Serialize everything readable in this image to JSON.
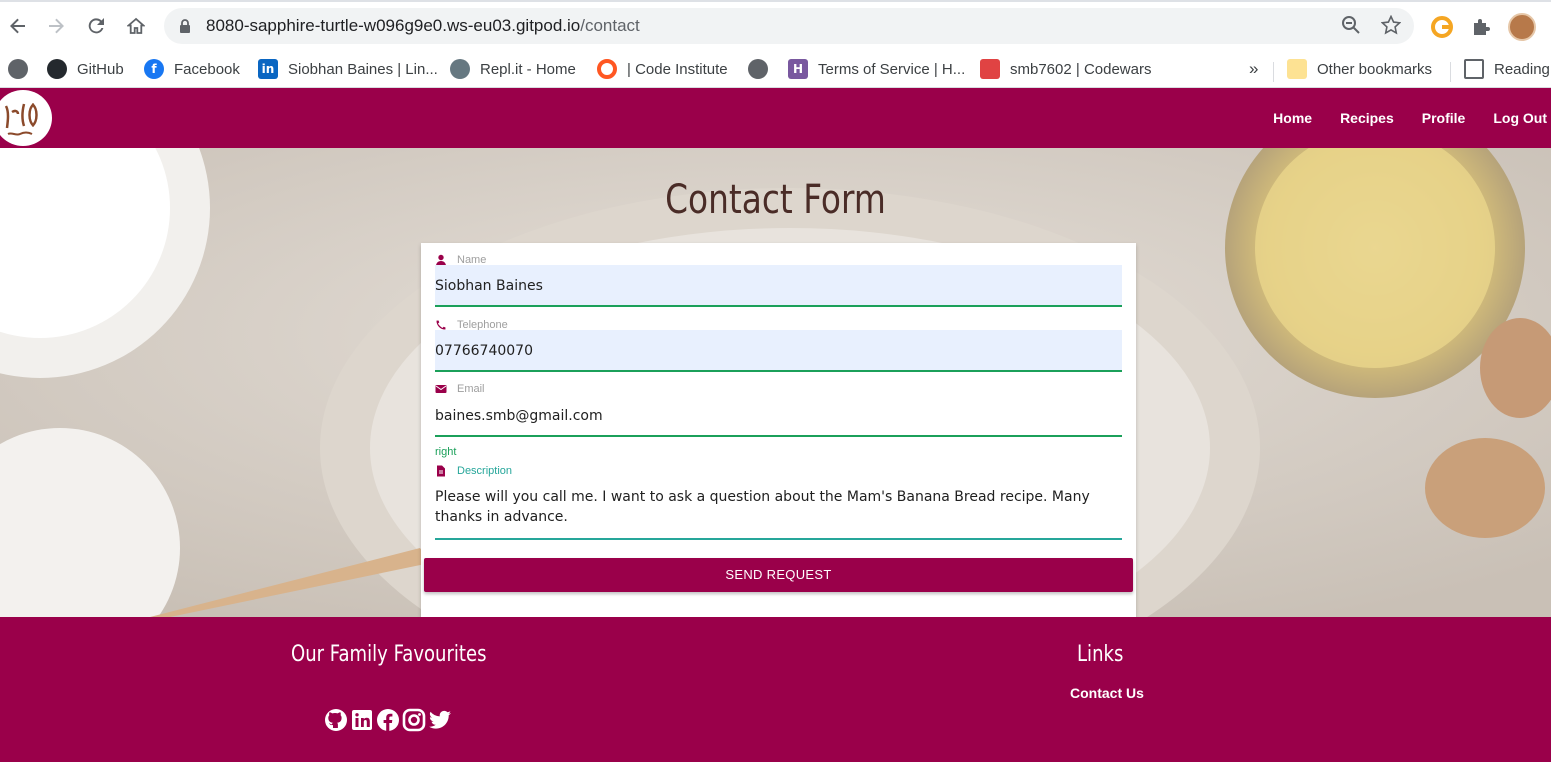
{
  "browser": {
    "url_host": "8080-sapphire-turtle-w096g9e0.ws-eu03.gitpod.io",
    "url_path": "/contact",
    "bookmarks": [
      {
        "label": "GitHub"
      },
      {
        "label": "Facebook"
      },
      {
        "label": "Siobhan Baines | Lin..."
      },
      {
        "label": "Repl.it - Home"
      },
      {
        "label": "| Code Institute"
      },
      {
        "label": "Terms of Service | H..."
      },
      {
        "label": "smb7602 | Codewars"
      }
    ],
    "overflow": "»",
    "other_bookmarks": "Other bookmarks",
    "reading_list": "Reading"
  },
  "nav": {
    "links": [
      "Home",
      "Recipes",
      "Profile",
      "Log Out"
    ]
  },
  "page": {
    "title": "Contact Form"
  },
  "form": {
    "name_label": "Name",
    "name_value": "Siobhan Baines",
    "telephone_label": "Telephone",
    "telephone_value": "07766740070",
    "email_label": "Email",
    "email_value": "baines.smb@gmail.com",
    "email_helper": "right",
    "description_label": "Description",
    "description_value": "Please will you call me. I want to ask a question about the Mam's Banana Bread recipe.  Many thanks in advance.",
    "submit_label": "SEND REQUEST"
  },
  "footer": {
    "favourites_title": "Our Family Favourites",
    "links_title": "Links",
    "contact_link": "Contact Us",
    "social_icons": [
      "github-icon",
      "linkedin-icon",
      "facebook-icon",
      "instagram-icon",
      "twitter-icon"
    ]
  },
  "colors": {
    "brand": "#9a004a",
    "valid": "#1ba05a",
    "title": "#4a2c27"
  }
}
